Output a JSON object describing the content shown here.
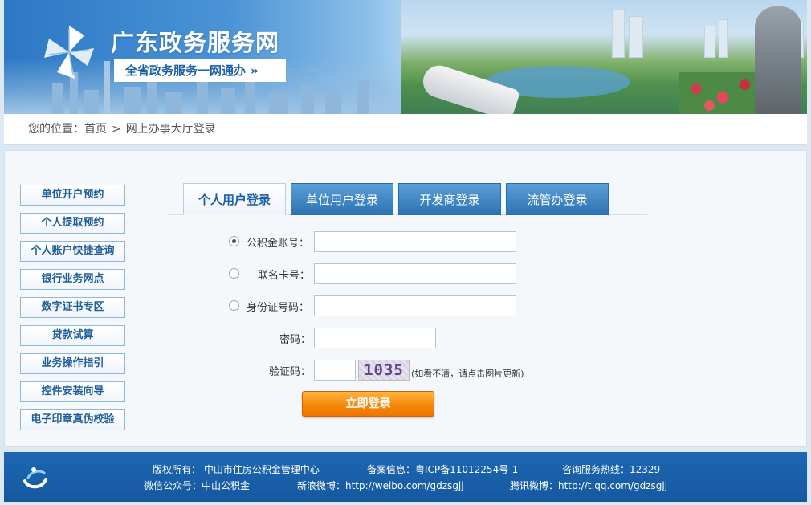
{
  "header": {
    "site_title": "广东政务服务网",
    "slogan": "全省政务服务一网通办",
    "slogan_arrow": "»"
  },
  "breadcrumb": {
    "prefix": "您的位置：",
    "home": "首页",
    "separator": ">",
    "current": "网上办事大厅登录"
  },
  "sidebar": {
    "items": [
      {
        "label": "单位开户预约"
      },
      {
        "label": "个人提取预约"
      },
      {
        "label": "个人账户快捷查询"
      },
      {
        "label": "银行业务网点"
      },
      {
        "label": "数字证书专区"
      },
      {
        "label": "贷款试算"
      },
      {
        "label": "业务操作指引"
      },
      {
        "label": "控件安装向导"
      },
      {
        "label": "电子印章真伪校验"
      }
    ]
  },
  "tabs": [
    {
      "label": "个人用户登录",
      "active": true
    },
    {
      "label": "单位用户登录",
      "active": false
    },
    {
      "label": "开发商登录",
      "active": false
    },
    {
      "label": "流管办登录",
      "active": false
    }
  ],
  "form": {
    "account_type_options": [
      {
        "label": "公积金账号：",
        "checked": true,
        "value": ""
      },
      {
        "label": "联名卡号：",
        "checked": false,
        "value": ""
      },
      {
        "label": "身份证号码：",
        "checked": false,
        "value": ""
      }
    ],
    "password_label": "密码：",
    "password_value": "",
    "captcha_label": "验证码：",
    "captcha_value": "",
    "captcha_text": "1035",
    "captcha_hint": "(如看不清，请点击图片更新)",
    "submit_label": "立即登录"
  },
  "footer": {
    "copyright": "版权所有： 中山市住房公积金管理中心",
    "icp": "备案信息：粤ICP备11012254号-1",
    "hotline": "咨询服务热线：12329",
    "wechat": "微信公众号：中山公积金",
    "sina_weibo": "新浪微博：http://weibo.com/gdzsgjj",
    "tencent_weibo": "腾讯微博：http://t.qq.com/gdzsgjj"
  },
  "colors": {
    "brand_blue": "#1d67b2",
    "tab_blue": "#2d73b5",
    "login_orange": "#f58a0b"
  }
}
